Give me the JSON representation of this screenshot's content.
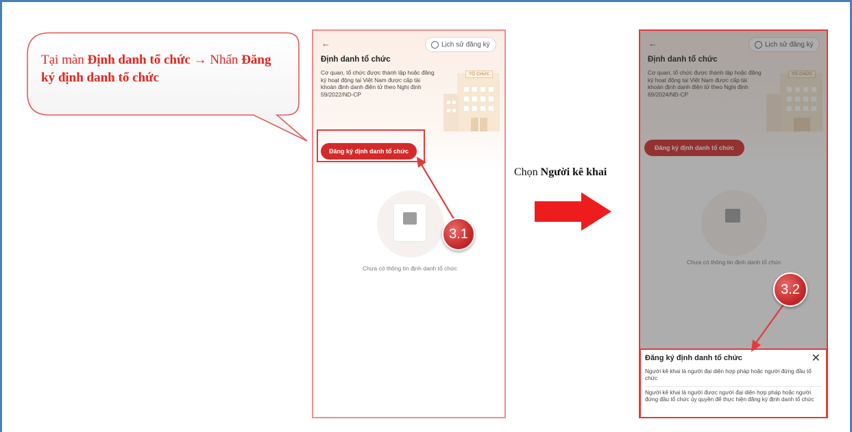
{
  "callout": {
    "prefix": "Tại màn ",
    "screen_name": "Định danh tổ chức",
    "arrow": " → ",
    "action_word": "Nhấn ",
    "button_name": "Đăng ký định danh tổ chức"
  },
  "middle_instruction": {
    "prefix": "Chọn ",
    "option": "Người kê khai"
  },
  "app_screen": {
    "back_glyph": "←",
    "history_button": "Lịch sử đăng ký",
    "title": "Định danh tổ chức",
    "description_phone1": "Cơ quan, tổ chức được thành lập hoặc đăng ký hoạt động tại Việt Nam được cấp tài khoản định danh điện tử theo Nghị định 59/2022/ND-CP",
    "description_phone2": "Cơ quan, tổ chức được thành lập hoặc đăng ký hoạt động tại Việt Nam được cấp tài khoản định danh điện tử theo Nghị định 69/2024/NĐ-CP",
    "building_sign": "TỔ CHỨC",
    "register_button": "Đăng ký định danh tổ chức",
    "empty_state": "Chưa có thông tin định danh tổ chức"
  },
  "bottom_sheet": {
    "title": "Đăng ký định danh tổ chức",
    "close_glyph": "✕",
    "option_1": "Người kê khai là người đại diện hợp pháp hoặc người đứng đầu tổ chức",
    "option_2": "Người kê khai là người được người đại diện hợp pháp hoặc người đứng đầu tổ chức ủy quyền để thực hiện đăng ký định danh tổ chức"
  },
  "steps": {
    "step1": "3.1",
    "step2": "3.2"
  },
  "colors": {
    "accent_red": "#d42a2a",
    "frame_blue": "#4a7ebb",
    "callout_text": "#e0261c"
  }
}
